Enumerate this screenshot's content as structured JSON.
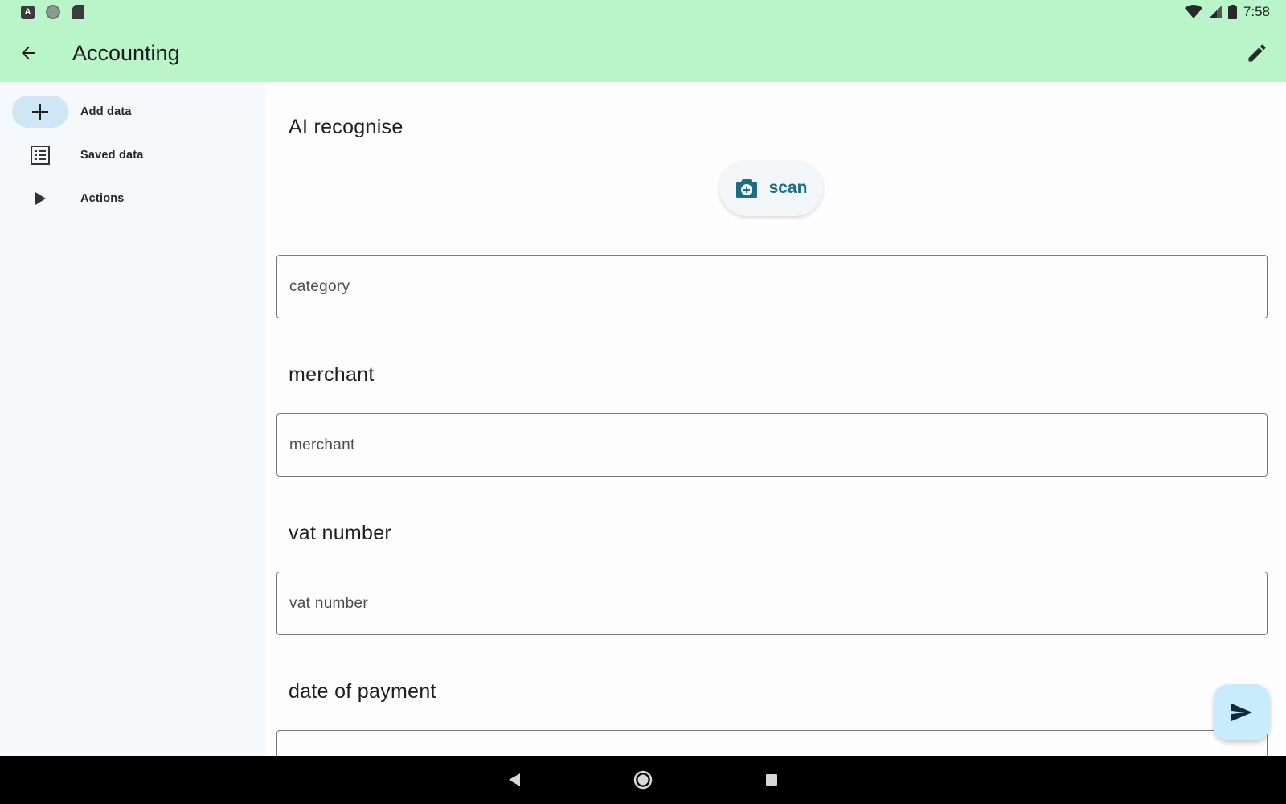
{
  "status_bar": {
    "time": "7:58",
    "left_icons": [
      "a-icon",
      "circle-icon",
      "sd-card-icon"
    ],
    "right_icons": [
      "wifi-icon",
      "signal-icon",
      "battery-icon"
    ]
  },
  "app_bar": {
    "title": "Accounting",
    "back_icon": "arrow-back-icon",
    "edit_icon": "pencil-icon",
    "background": "#baf5ca"
  },
  "nav_rail": {
    "items": [
      {
        "label": "Add data",
        "icon": "plus-icon",
        "active": true
      },
      {
        "label": "Saved data",
        "icon": "list-icon",
        "active": false
      },
      {
        "label": "Actions",
        "icon": "play-icon",
        "active": false
      }
    ]
  },
  "main": {
    "ai_section": {
      "title": "AI recognise",
      "scan_button_label": "scan",
      "scan_icon": "camera-plus-icon"
    },
    "fields": [
      {
        "title": "",
        "placeholder": "category",
        "value": ""
      },
      {
        "title": "merchant",
        "placeholder": "merchant",
        "value": ""
      },
      {
        "title": "vat number",
        "placeholder": "vat number",
        "value": ""
      },
      {
        "title": "date of payment",
        "placeholder": "",
        "value": ""
      }
    ]
  },
  "fab": {
    "icon": "send-icon"
  },
  "system_nav": {
    "icons": [
      "back-triangle-icon",
      "home-circle-icon",
      "recents-square-icon"
    ]
  },
  "colors": {
    "accent": "#1c6e86",
    "rail_active": "#cfe6f4",
    "fab": "#c9ecfc"
  }
}
